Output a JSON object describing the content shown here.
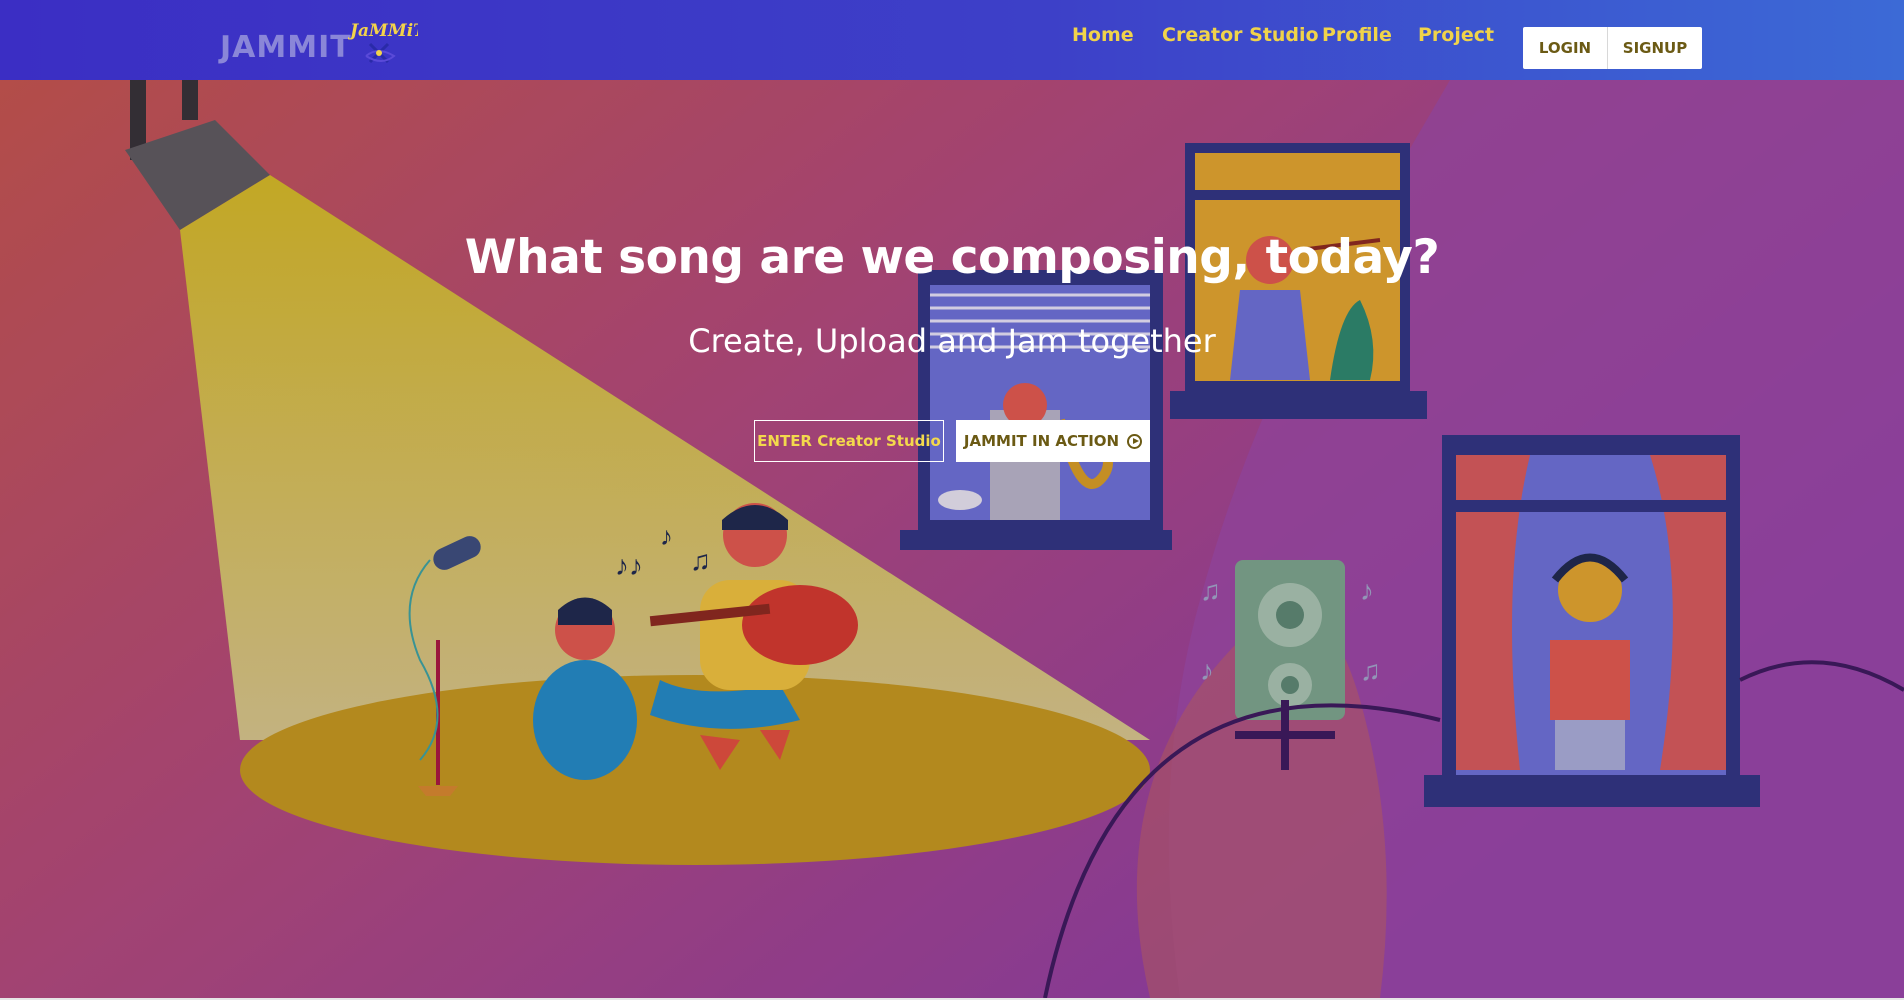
{
  "brand": {
    "name": "JAMMIT",
    "logo_text": "JaMMiT"
  },
  "nav": {
    "links": [
      {
        "label": "Home"
      },
      {
        "label": "Creator Studio"
      },
      {
        "label": "Profile"
      },
      {
        "label": "Project"
      }
    ],
    "login_label": "LOGIN",
    "signup_label": "SIGNUP"
  },
  "hero": {
    "title": "What song are we composing, today?",
    "subtitle": "Create, Upload and Jam together",
    "primary_cta": "ENTER Creator Studio",
    "secondary_cta": "JAMMIT IN ACTION"
  },
  "colors": {
    "nav_bg": "#3b3fc8",
    "nav_link": "#f0d34a",
    "cta_text": "#6b5a14",
    "hero_gradient_start": "#c4564a",
    "hero_gradient_end": "#8a3da8"
  },
  "icons": {
    "play": "play-circle-icon"
  }
}
